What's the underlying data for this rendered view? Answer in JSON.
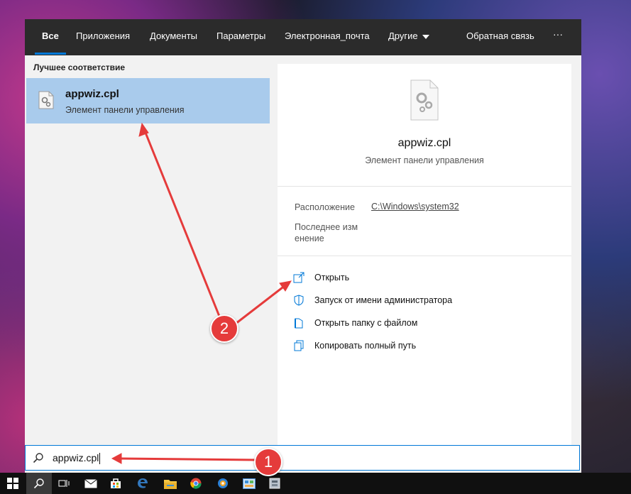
{
  "tabs": {
    "all": "Все",
    "apps": "Приложения",
    "documents": "Документы",
    "settings": "Параметры",
    "email": "Электронная_почта",
    "other": "Другие",
    "feedback": "Обратная связь",
    "more": "···"
  },
  "results": {
    "section_title": "Лучшее соответствие",
    "best_match": {
      "name": "appwiz.cpl",
      "subtitle": "Элемент панели управления"
    }
  },
  "preview": {
    "name": "appwiz.cpl",
    "subtitle": "Элемент панели управления",
    "location_label": "Расположение",
    "location_value": "C:\\Windows\\system32",
    "modified_label_1": "Последнее изм",
    "modified_label_2": "енение",
    "actions": [
      {
        "label": "Открыть",
        "icon": "open-icon"
      },
      {
        "label": "Запуск от имени администратора",
        "icon": "shield-icon"
      },
      {
        "label": "Открыть папку с файлом",
        "icon": "folder-icon"
      },
      {
        "label": "Копировать полный путь",
        "icon": "copy-icon"
      }
    ]
  },
  "search": {
    "value": "appwiz.cpl"
  },
  "annotations": {
    "badge_1": "1",
    "badge_2": "2"
  },
  "colors": {
    "accent": "#0078d7",
    "selection": "#a9cbec",
    "annotation": "#e53b3b",
    "topbar": "#2b2b2b"
  },
  "taskbar": [
    "windows-start-icon",
    "search-icon",
    "task-view-icon",
    "mail-icon",
    "store-icon",
    "edge-icon",
    "file-explorer-icon",
    "chrome-icon",
    "app-icon",
    "control-panel-icon",
    "archive-icon"
  ]
}
